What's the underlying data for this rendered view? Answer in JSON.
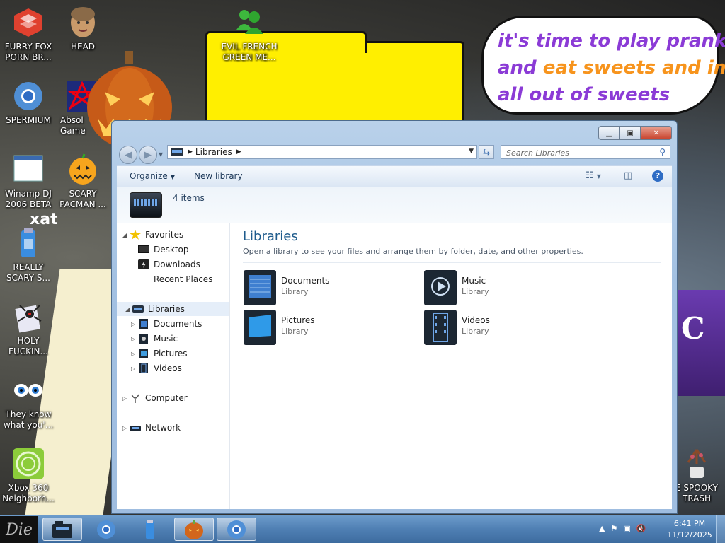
{
  "desktop": {
    "bubble": {
      "line1": "it's time to play pranks",
      "line2_a": "and ",
      "line2_b": "eat sweets and im",
      "line3": "all out of sweets"
    },
    "xat": "xat",
    "gravestone_letter": "C",
    "icons": [
      {
        "label": "FURRY FOX\nPORN BR...",
        "icon": "browser-icon"
      },
      {
        "label": "HEAD",
        "icon": "head-icon"
      },
      {
        "label": "EVIL FRENCH\nGREEN ME...",
        "icon": "messenger-icon"
      },
      {
        "label": "SPERMIUM",
        "icon": "chromium-icon"
      },
      {
        "label": "Absol\nGame",
        "icon": "game-icon"
      },
      {
        "label": "Winamp DJ\n2006 BETA",
        "icon": "winamp-icon"
      },
      {
        "label": "SCARY\nPACMAN ...",
        "icon": "pacman-icon"
      },
      {
        "label": "REALLY\nSCARY S...",
        "icon": "usb-icon"
      },
      {
        "label": "HOLY\nFUCKIN...",
        "icon": "spider-icon"
      },
      {
        "label": "They know\nwhat you'...",
        "icon": "eyes-icon"
      },
      {
        "label": "Xbox 360\nNeighborh...",
        "icon": "xbox-icon"
      },
      {
        "label": "E SPOOKY\nTRASH",
        "icon": "trash-icon"
      }
    ]
  },
  "window": {
    "address": {
      "crumb": "Libraries"
    },
    "search": {
      "placeholder": "Search Libraries"
    },
    "toolbar": {
      "organize": "Organize",
      "new_library": "New library"
    },
    "details": {
      "count": "4 items"
    },
    "nav": {
      "favorites": "Favorites",
      "desktop": "Desktop",
      "downloads": "Downloads",
      "recent_places": "Recent Places",
      "libraries": "Libraries",
      "documents": "Documents",
      "music": "Music",
      "pictures": "Pictures",
      "videos": "Videos",
      "computer": "Computer",
      "network": "Network"
    },
    "content": {
      "title": "Libraries",
      "subtitle": "Open a library to see your files and arrange them by folder, date, and other properties.",
      "libraries": [
        {
          "name": "Documents",
          "type": "Library"
        },
        {
          "name": "Music",
          "type": "Library"
        },
        {
          "name": "Pictures",
          "type": "Library"
        },
        {
          "name": "Videos",
          "type": "Library"
        }
      ]
    }
  },
  "taskbar": {
    "start_label": "Die",
    "time": "6:41 PM",
    "date": "11/12/2025"
  },
  "colors": {
    "bubble_purple": "#8b3bd6",
    "bubble_orange": "#f7941d",
    "yellow_shape": "#ffef00",
    "title_blue": "#1e5b8c"
  }
}
